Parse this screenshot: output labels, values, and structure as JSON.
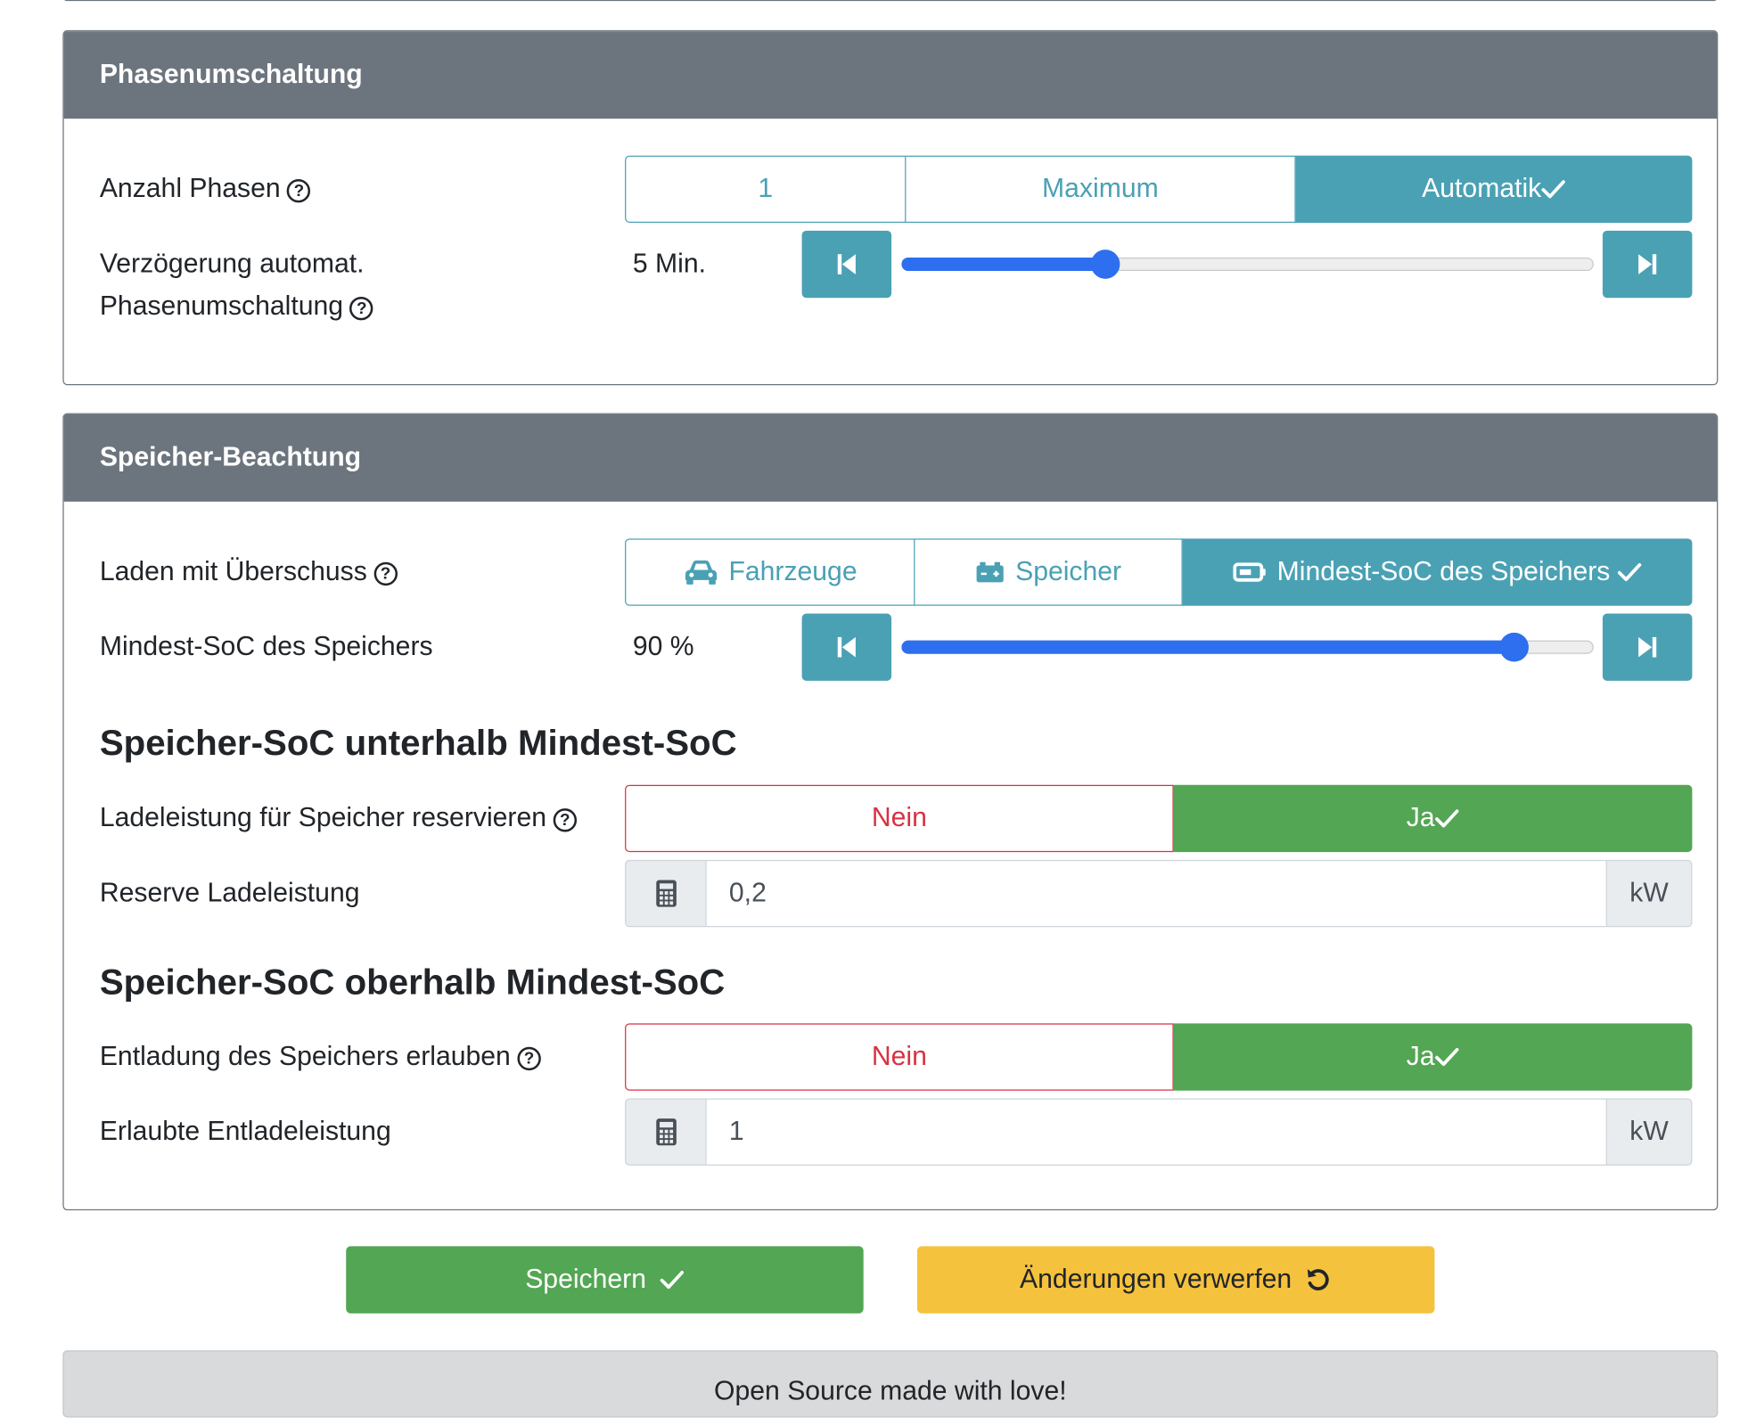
{
  "phase_card": {
    "title": "Phasenumschaltung",
    "phases": {
      "label": "Anzahl Phasen",
      "options": [
        "1",
        "Maximum",
        "Automatik"
      ],
      "selected": "Automatik"
    },
    "delay": {
      "label_line1": "Verzögerung automat.",
      "label_line2": "Phasenumschaltung",
      "value": "5 Min.",
      "slider_fraction": 0.295
    }
  },
  "storage_card": {
    "title": "Speicher-Beachtung",
    "surplus": {
      "label": "Laden mit Überschuss",
      "options": [
        "Fahrzeuge",
        "Speicher",
        "Mindest-SoC des Speichers"
      ],
      "selected": "Mindest-SoC des Speichers"
    },
    "min_soc": {
      "label": "Mindest-SoC des Speichers",
      "value": "90 %",
      "slider_fraction": 0.885
    },
    "below": {
      "heading": "Speicher-SoC unterhalb Mindest-SoC",
      "reserve_label": "Ladeleistung für Speicher reservieren",
      "no_label": "Nein",
      "yes_label": "Ja",
      "selected": "Ja",
      "power_label": "Reserve Ladeleistung",
      "power_value": "0,2",
      "unit": "kW"
    },
    "above": {
      "heading": "Speicher-SoC oberhalb Mindest-SoC",
      "discharge_label": "Entladung des Speichers erlauben",
      "no_label": "Nein",
      "yes_label": "Ja",
      "selected": "Ja",
      "power_label": "Erlaubte Entladeleistung",
      "power_value": "1",
      "unit": "kW"
    }
  },
  "actions": {
    "save_label": "Speichern",
    "discard_label": "Änderungen verwerfen"
  },
  "footer": {
    "text": "Open Source made with love!"
  },
  "colors": {
    "header_bg": "#6c757d",
    "info": "#4aa1b4",
    "success": "#53a653",
    "danger": "#d63343",
    "warning": "#f5c23e",
    "slider": "#2d6fef"
  },
  "icons": {
    "help": "question-circle-icon",
    "check": "check-icon",
    "step_back": "step-backward-icon",
    "step_forward": "step-forward-icon",
    "vehicle": "car-icon",
    "battery": "car-battery-icon",
    "battery_level": "battery-icon",
    "calculator": "calculator-icon",
    "undo": "undo-icon"
  }
}
